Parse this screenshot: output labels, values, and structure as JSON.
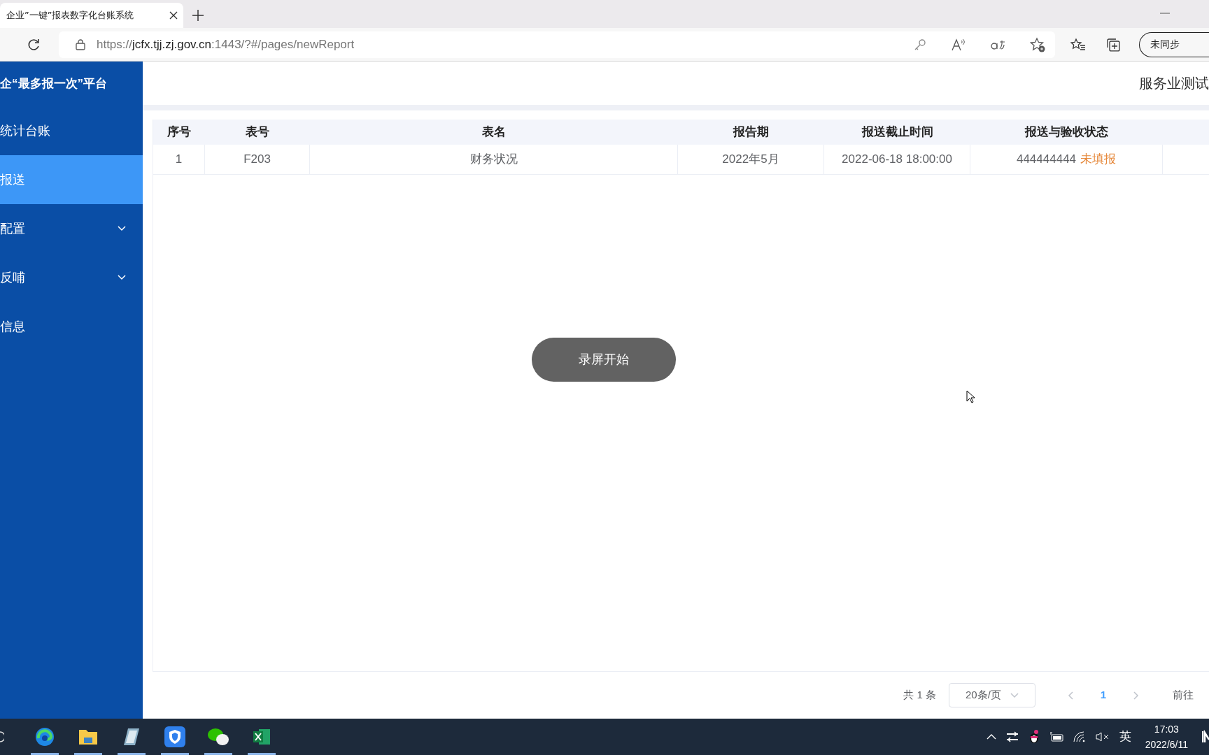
{
  "browser": {
    "tab": {
      "title": "企业”一键”报表数字化台账系统"
    },
    "url": {
      "scheme": "https://",
      "host": "jcfx.tjj.zj.gov.cn",
      "rest": ":1443/?#/pages/newReport"
    },
    "sync_button": "未同步"
  },
  "sidebar": {
    "title": "企“最多报一次”平台",
    "items": [
      {
        "label": "统计台账",
        "selected": false,
        "expandable": false
      },
      {
        "label": "报送",
        "selected": true,
        "expandable": false
      },
      {
        "label": "配置",
        "selected": false,
        "expandable": true
      },
      {
        "label": "反哺",
        "selected": false,
        "expandable": true
      },
      {
        "label": "信息",
        "selected": false,
        "expandable": false
      }
    ]
  },
  "header": {
    "user": "服务业测试"
  },
  "table": {
    "columns": [
      "序号",
      "表号",
      "表名",
      "报告期",
      "报送截止时间",
      "报送与验收状态"
    ],
    "rows": [
      {
        "cells": [
          "1",
          "F203",
          "财务状况",
          "2022年5月",
          "2022-06-18 18:00:00"
        ],
        "status_code": "444444444",
        "status": "未填报"
      }
    ]
  },
  "pagination": {
    "total": "共 1 条",
    "page_size": "20条/页",
    "pages": [
      {
        "label": "1",
        "selected": true
      }
    ],
    "goto": "前往"
  },
  "toast": "录屏开始",
  "taskbar": {
    "apps": [
      {
        "kind": "edge",
        "running": true
      },
      {
        "kind": "folder",
        "running": true
      },
      {
        "kind": "notepad",
        "running": true
      },
      {
        "kind": "shield",
        "running": true
      },
      {
        "kind": "chat",
        "running": true
      },
      {
        "kind": "sheet",
        "running": true
      }
    ],
    "tray": {
      "ime": "英",
      "time": "17:03",
      "date": "2022/6/11"
    }
  }
}
